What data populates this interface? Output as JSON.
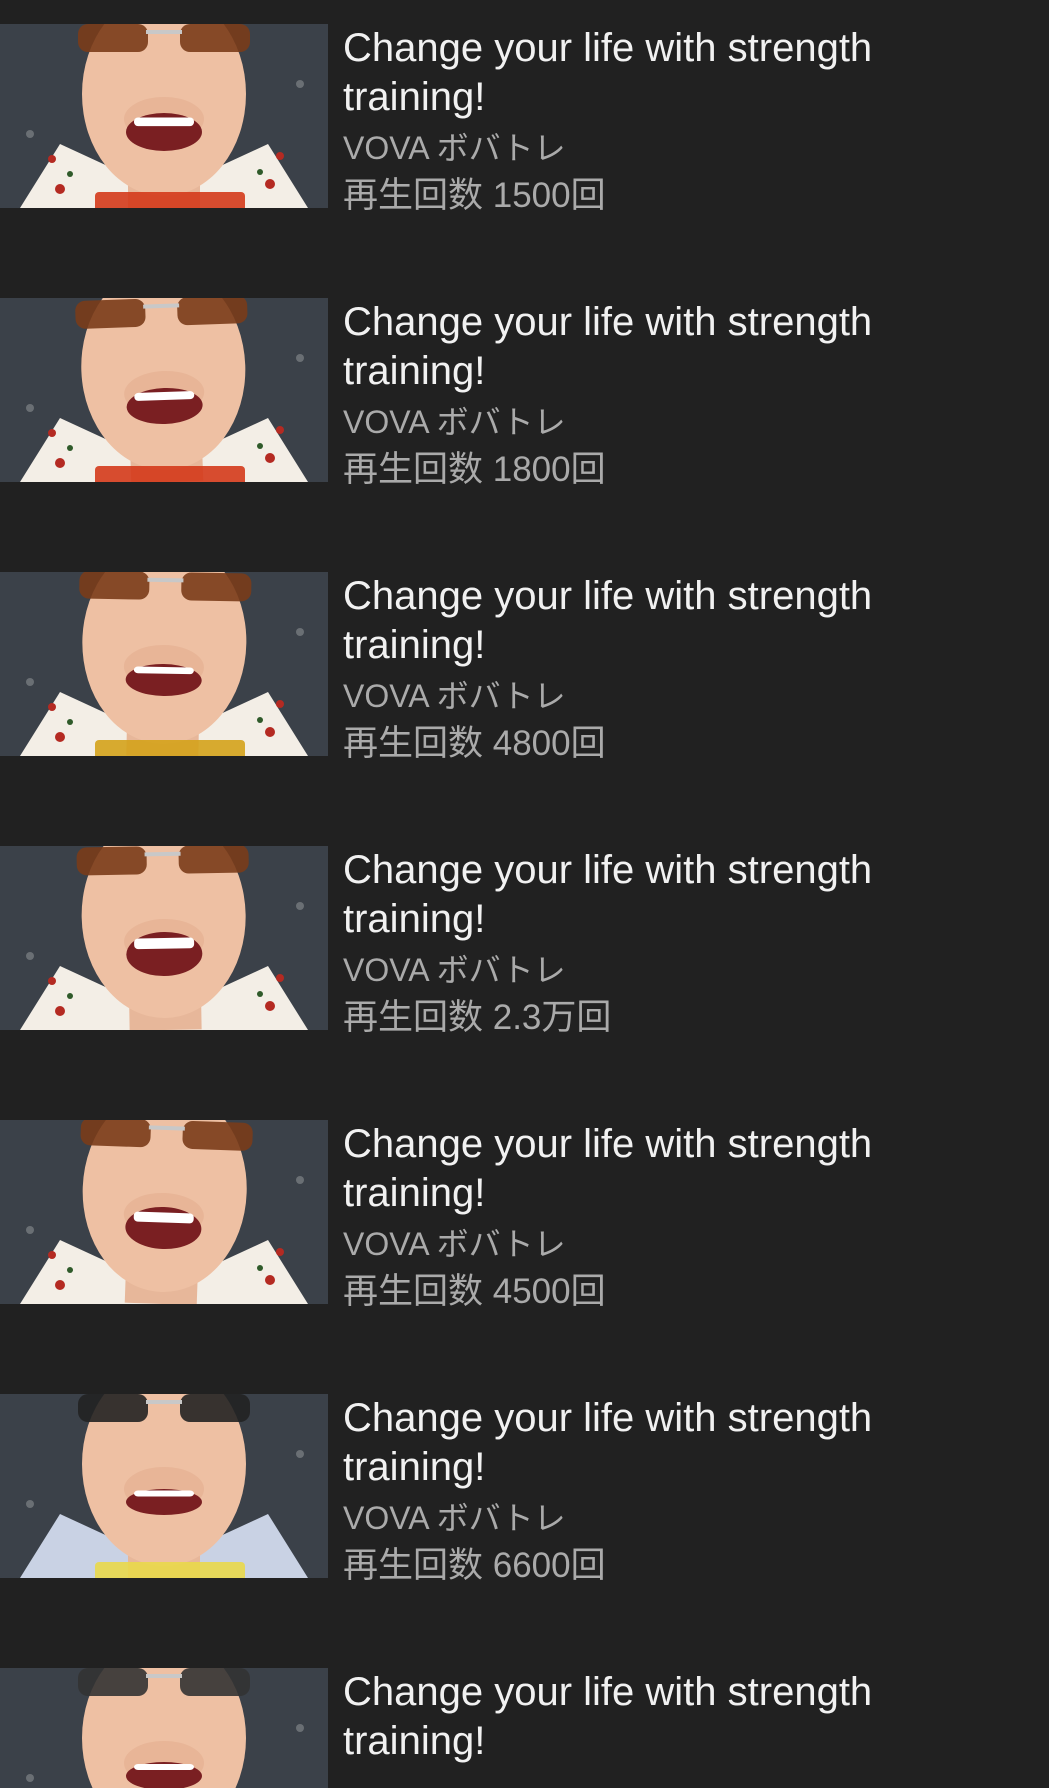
{
  "feed": {
    "items": [
      {
        "title": "Change your life with strength training!",
        "channel": "VOVA ボバトレ",
        "views": "再生回数 1500回",
        "shirt": "#f3eee6",
        "glasses": "#7a3c1a",
        "caption": "#d43a1b"
      },
      {
        "title": "Change your life with strength training!",
        "channel": "VOVA ボバトレ",
        "views": "再生回数 1800回",
        "shirt": "#f3eee6",
        "glasses": "#7a3c1a",
        "caption": "#d43a1b"
      },
      {
        "title": "Change your life with strength training!",
        "channel": "VOVA ボバトレ",
        "views": "再生回数 4800回",
        "shirt": "#f3eee6",
        "glasses": "#7a3c1a",
        "caption": "#d4a21b"
      },
      {
        "title": "Change your life with strength training!",
        "channel": "VOVA ボバトレ",
        "views": "再生回数 2.3万回",
        "shirt": "#f3eee6",
        "glasses": "#7a3c1a",
        "caption": ""
      },
      {
        "title": "Change your life with strength training!",
        "channel": "VOVA ボバトレ",
        "views": "再生回数 4500回",
        "shirt": "#f3eee6",
        "glasses": "#7a3c1a",
        "caption": ""
      },
      {
        "title": "Change your life with strength training!",
        "channel": "VOVA ボバトレ",
        "views": "再生回数 6600回",
        "shirt": "#c9d2e4",
        "glasses": "#222222",
        "caption": "#e9d84a"
      },
      {
        "title": "Change your life with strength training!",
        "channel": "",
        "views": "",
        "shirt": "#c9d2e4",
        "glasses": "#333333",
        "caption": ""
      }
    ]
  }
}
